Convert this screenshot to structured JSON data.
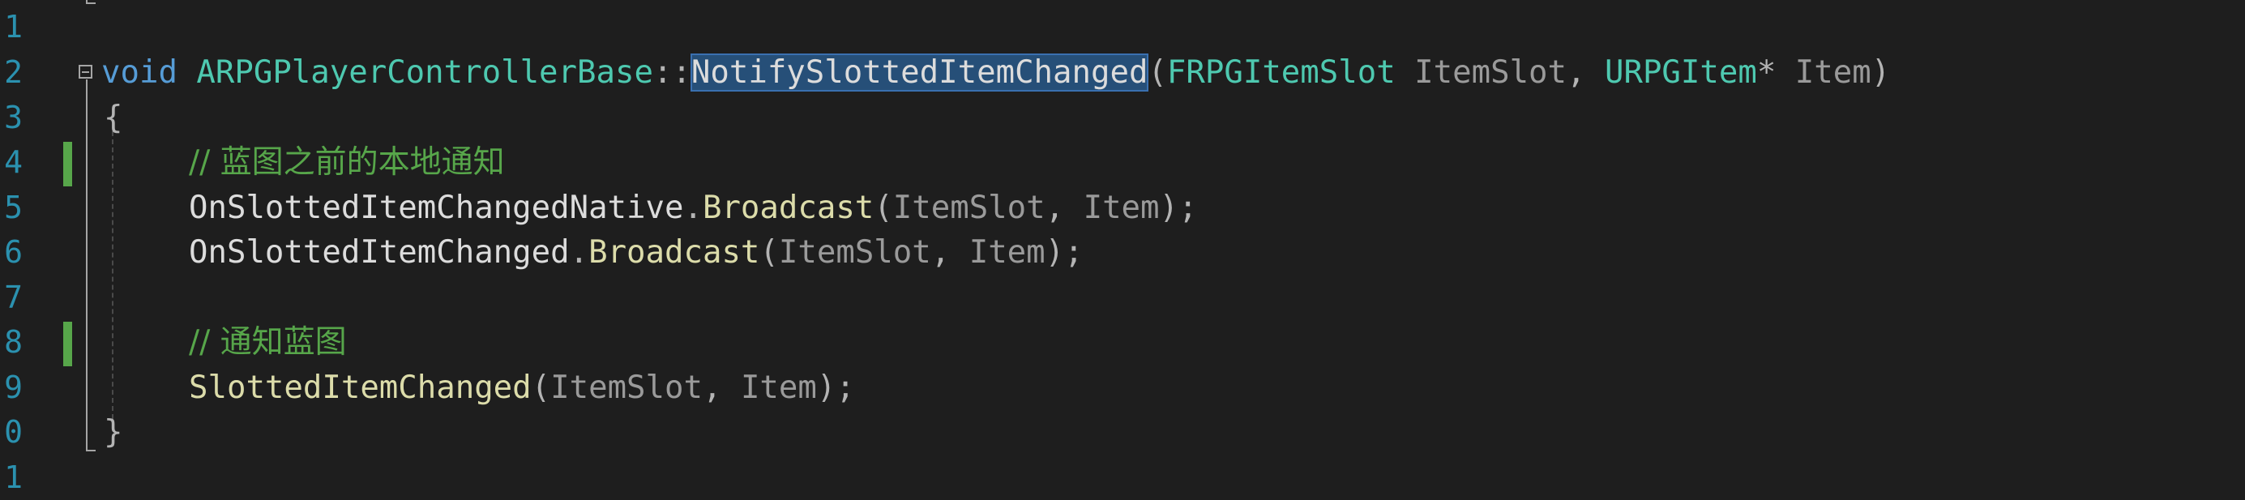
{
  "editor": {
    "line_numbers": [
      "1",
      "2",
      "3",
      "4",
      "5",
      "6",
      "7",
      "8",
      "9",
      "0",
      "1"
    ],
    "line2": {
      "kw_void": "void",
      "class_name": "ARPGPlayerControllerBase",
      "scope": "::",
      "method": "NotifySlottedItemChanged",
      "open_paren": "(",
      "type1": "FRPGItemSlot",
      "param1": "ItemSlot",
      "comma": ",",
      "type2": "URPGItem",
      "star": "*",
      "param2": "Item",
      "close_paren": ")"
    },
    "line3": {
      "brace": "{"
    },
    "line4": {
      "comment": "// 蓝图之前的本地通知"
    },
    "line5": {
      "object": "OnSlottedItemChangedNative",
      "dot": ".",
      "call": "Broadcast",
      "open": "(",
      "arg1": "ItemSlot",
      "comma": ",",
      "arg2": "Item",
      "close": ");"
    },
    "line6": {
      "object": "OnSlottedItemChanged",
      "dot": ".",
      "call": "Broadcast",
      "open": "(",
      "arg1": "ItemSlot",
      "comma": ",",
      "arg2": "Item",
      "close": ");"
    },
    "line8": {
      "comment": "// 通知蓝图"
    },
    "line9": {
      "call": "SlottedItemChanged",
      "open": "(",
      "arg1": "ItemSlot",
      "comma": ",",
      "arg2": "Item",
      "close": ");"
    },
    "line10": {
      "brace": "}"
    }
  },
  "colors": {
    "background": "#1e1e1e",
    "keyword": "#569cd6",
    "type": "#4ec9b0",
    "function": "#dcdcaa",
    "comment": "#57a64a",
    "line_number": "#2b91af",
    "selection": "#264f78"
  }
}
